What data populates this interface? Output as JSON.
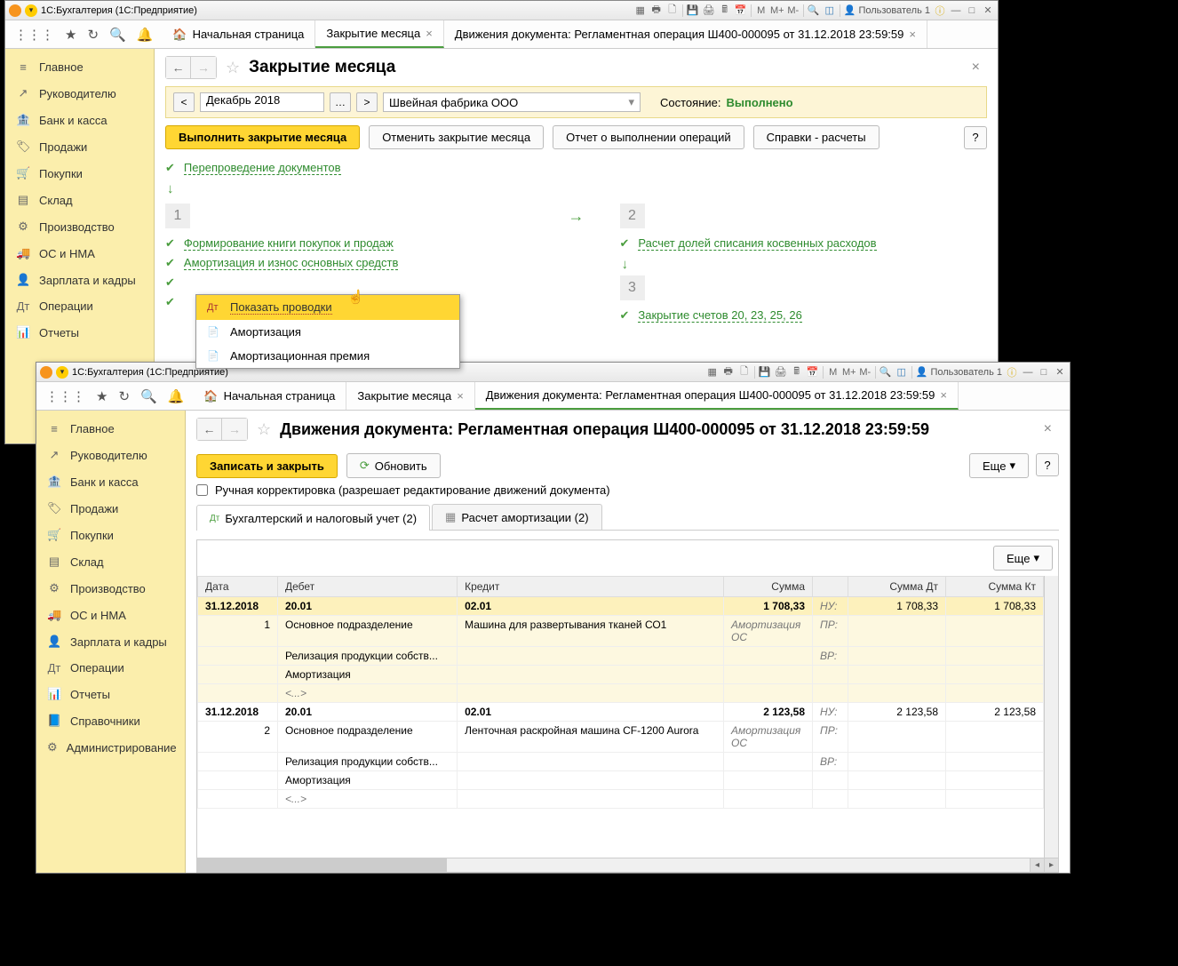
{
  "win1": {
    "app_title": "1С:Бухгалтерия  (1С:Предприятие)",
    "user": "Пользователь 1",
    "tabs": {
      "home": "Начальная страница",
      "t1": "Закрытие месяца",
      "t2": "Движения документа: Регламентная операция Ш400-000095 от 31.12.2018 23:59:59"
    },
    "sidebar": [
      {
        "icon": "≡",
        "label": "Главное"
      },
      {
        "icon": "↗",
        "label": "Руководителю"
      },
      {
        "icon": "🏦",
        "label": "Банк и касса"
      },
      {
        "icon": "🏷",
        "label": "Продажи"
      },
      {
        "icon": "🛒",
        "label": "Покупки"
      },
      {
        "icon": "▤",
        "label": "Склад"
      },
      {
        "icon": "⚙",
        "label": "Производство"
      },
      {
        "icon": "🚚",
        "label": "ОС и НМА"
      },
      {
        "icon": "👤",
        "label": "Зарплата и кадры"
      },
      {
        "icon": "Дт",
        "label": "Операции"
      },
      {
        "icon": "📊",
        "label": "Отчеты"
      },
      {
        "icon": "📘",
        "label": "Справочники"
      },
      {
        "icon": "⚙",
        "label": "Администрирование"
      }
    ],
    "page": {
      "title": "Закрытие месяца",
      "period": "Декабрь 2018",
      "org": "Швейная фабрика ООО",
      "state_label": "Состояние:",
      "state_value": "Выполнено",
      "btn_exec": "Выполнить закрытие месяца",
      "btn_cancel": "Отменить закрытие месяца",
      "btn_report": "Отчет о выполнении операций",
      "btn_ref": "Справки - расчеты",
      "repost": "Перепроведение документов",
      "stage1": {
        "num": "1",
        "l1": "Формирование книги покупок и продаж",
        "l2": "Амортизация и износ основных средств"
      },
      "stage2": {
        "num": "2",
        "l1": "Расчет долей списания косвенных расходов"
      },
      "stage3": {
        "num": "3",
        "l1": "Закрытие счетов 20, 23, 25, 26"
      },
      "ctx": {
        "i1": "Показать проводки",
        "i2": "Амортизация",
        "i3": "Амортизационная премия"
      }
    }
  },
  "win2": {
    "app_title": "1С:Бухгалтерия  (1С:Предприятие)",
    "user": "Пользователь 1",
    "tabs": {
      "home": "Начальная страница",
      "t1": "Закрытие месяца",
      "t2": "Движения документа: Регламентная операция Ш400-000095 от 31.12.2018 23:59:59"
    },
    "page": {
      "title": "Движения документа: Регламентная операция Ш400-000095 от 31.12.2018 23:59:59",
      "btn_save": "Записать и закрыть",
      "btn_refresh": "Обновить",
      "btn_more": "Еще",
      "manual_corr": "Ручная корректировка (разрешает редактирование движений документа)",
      "tab1": "Бухгалтерский и налоговый учет (2)",
      "tab2": "Расчет амортизации (2)",
      "cols": {
        "date": "Дата",
        "debit": "Дебет",
        "credit": "Кредит",
        "sum": "Сумма",
        "sumdt": "Сумма Дт",
        "sumkt": "Сумма Кт"
      },
      "rows": [
        {
          "date": "31.12.2018",
          "n": "1",
          "debit": "20.01",
          "credit": "02.01",
          "sum": "1 708,33",
          "nu": "НУ:",
          "sumdt": "1 708,33",
          "sumkt": "1 708,33",
          "d2": "Основное подразделение",
          "c2": "Машина для развертывания тканей СО1",
          "s2": "Амортизация ОС",
          "pr": "ПР:",
          "d3": "Релизация продукции собств...",
          "vr": "ВР:",
          "d4": "Амортизация",
          "d5": "<...>"
        },
        {
          "date": "31.12.2018",
          "n": "2",
          "debit": "20.01",
          "credit": "02.01",
          "sum": "2 123,58",
          "nu": "НУ:",
          "sumdt": "2 123,58",
          "sumkt": "2 123,58",
          "d2": "Основное подразделение",
          "c2": "Ленточная раскройная машина CF-1200 Aurora",
          "s2": "Амортизация ОС",
          "pr": "ПР:",
          "d3": "Релизация продукции собств...",
          "vr": "ВР:",
          "d4": "Амортизация",
          "d5": "<...>"
        }
      ]
    }
  },
  "toolbar_letters": {
    "m": "M",
    "mp": "M+",
    "mm": "M-"
  }
}
